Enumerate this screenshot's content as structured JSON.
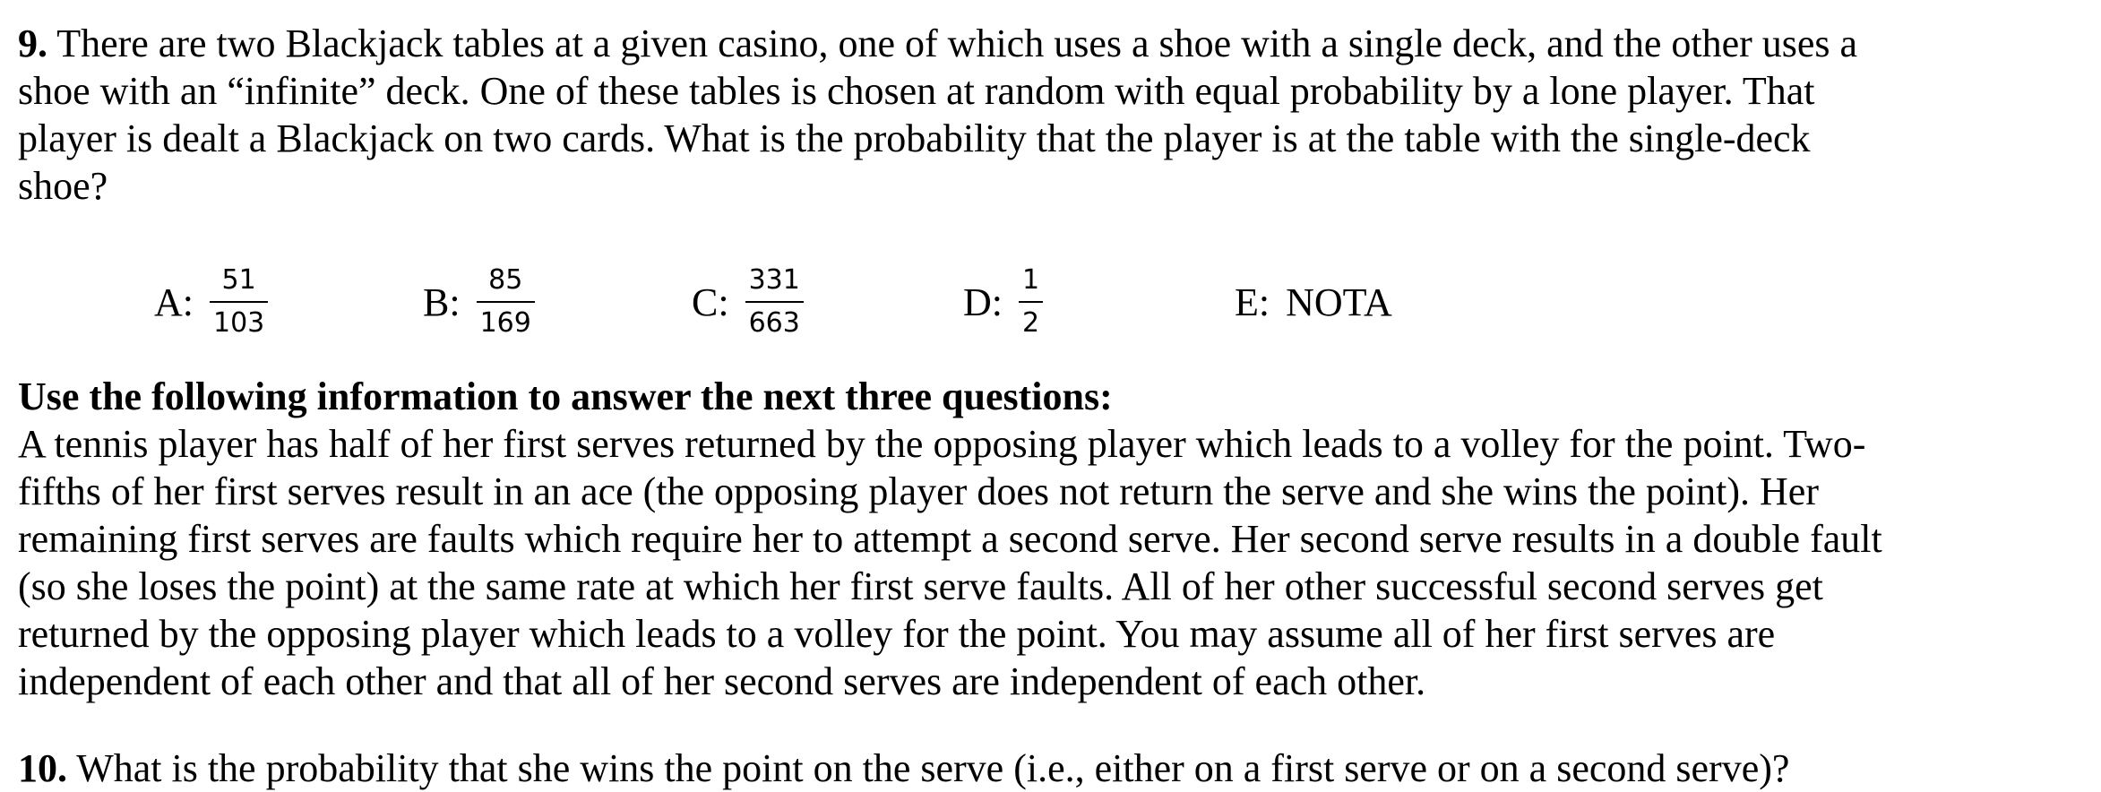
{
  "question9": {
    "number": "9.",
    "text": " There are two Blackjack tables at a given casino, one of which uses a shoe with a single deck, and the other uses a shoe with an “infinite” deck.  One of these tables is chosen at random with equal probability by a lone player.  That player is dealt a Blackjack on two cards.  What is the probability that the player is at the table with the single-deck shoe?",
    "choices": [
      {
        "letter": "A:",
        "numerator": "51",
        "denominator": "103"
      },
      {
        "letter": "B:",
        "numerator": "85",
        "denominator": "169"
      },
      {
        "letter": "C:",
        "numerator": "331",
        "denominator": "663"
      },
      {
        "letter": "D:",
        "numerator": "1",
        "denominator": "2"
      },
      {
        "letter": "E:",
        "text": "NOTA"
      }
    ]
  },
  "info_block": {
    "heading": "Use the following information to answer the next three questions:",
    "text": "A tennis player has half of her first serves returned by the opposing player which leads to a volley for the point.  Two-fifths of her first serves result in an ace (the opposing player does not return the serve and she wins the point).  Her remaining first serves are faults which require her to attempt a second serve.  Her second serve results in a double fault (so she loses the point) at the same rate at which her first serve faults.  All of her other successful second serves get returned by the opposing player which leads to a volley for the point.  You may assume all of her first serves are independent of each other and that all of her second serves are independent of each other."
  },
  "question10": {
    "number": "10.",
    "text": " What is the probability that she wins the point on the serve (i.e., either on a first serve or on a second serve)?"
  }
}
